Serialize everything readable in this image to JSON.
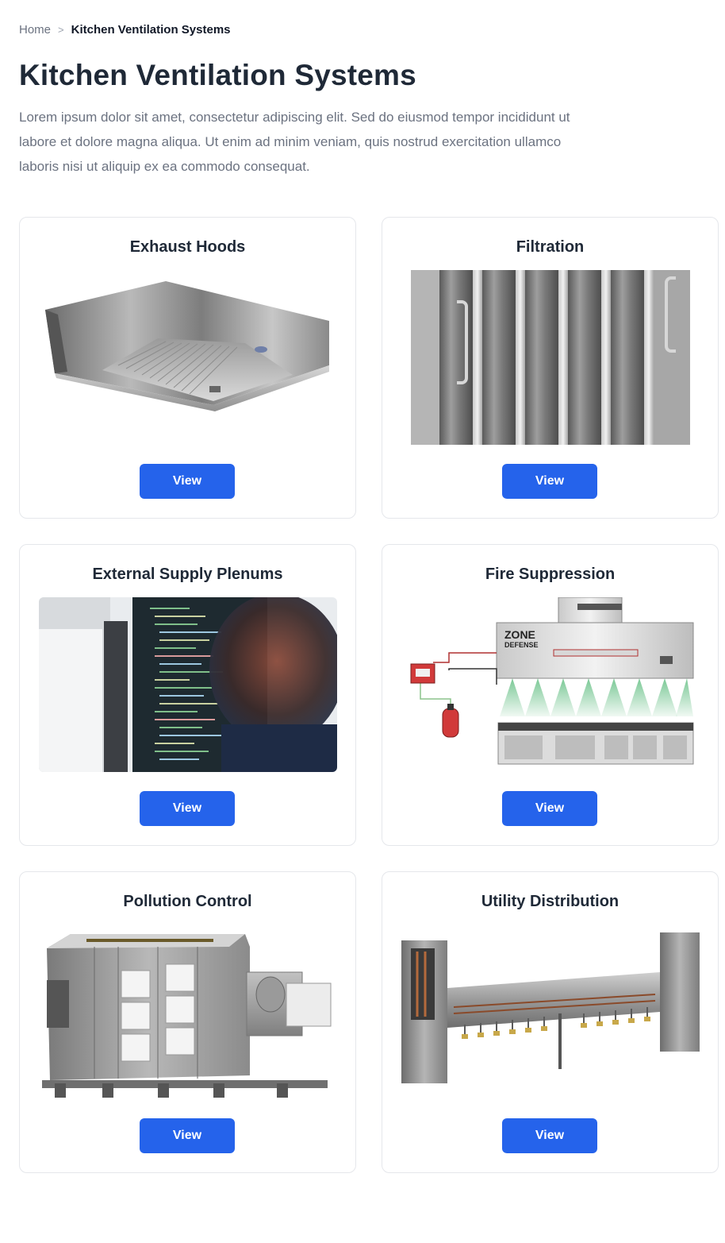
{
  "breadcrumb": {
    "home": "Home",
    "separator": ">",
    "current": "Kitchen Ventilation Systems"
  },
  "page": {
    "title": "Kitchen Ventilation Systems",
    "description": "Lorem ipsum dolor sit amet, consectetur adipiscing elit. Sed do eiusmod tempor incididunt ut labore et dolore magna aliqua. Ut enim ad minim veniam, quis nostrud exercitation ullamco laboris nisi ut aliquip ex ea commodo consequat."
  },
  "cards": [
    {
      "title": "Exhaust Hoods",
      "button": "View",
      "image": "exhaust-hood-image"
    },
    {
      "title": "Filtration",
      "button": "View",
      "image": "baffle-filter-image"
    },
    {
      "title": "External Supply Plenums",
      "button": "View",
      "image": "developer-monitor-photo"
    },
    {
      "title": "Fire Suppression",
      "button": "View",
      "image": "fire-suppression-diagram",
      "logo_line1": "ZONE",
      "logo_line2": "DEFENSE"
    },
    {
      "title": "Pollution Control",
      "button": "View",
      "image": "pollution-control-unit-image"
    },
    {
      "title": "Utility Distribution",
      "button": "View",
      "image": "utility-distribution-image"
    }
  ],
  "colors": {
    "accent": "#2563eb",
    "text_dark": "#1f2937",
    "text_muted": "#6b7280",
    "border": "#e5e7eb"
  }
}
